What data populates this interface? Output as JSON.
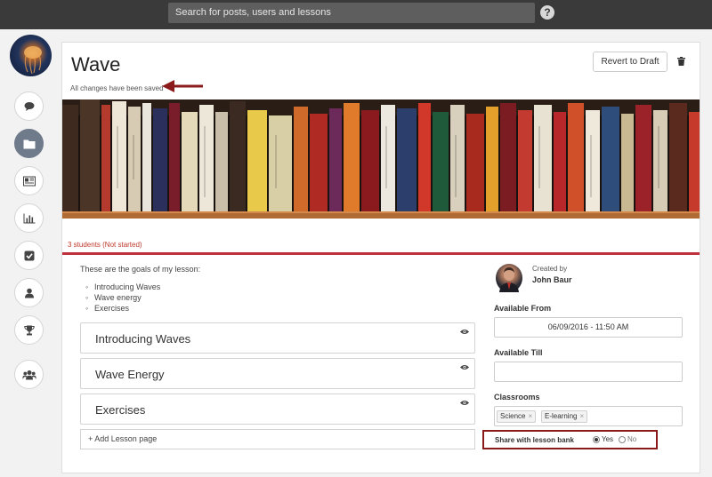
{
  "topbar": {
    "search_placeholder": "Search for posts, users and lessons",
    "help_label": "?"
  },
  "sidebar": {
    "items": [
      {
        "name": "comment-icon",
        "active": false
      },
      {
        "name": "folder-icon",
        "active": true
      },
      {
        "name": "newspaper-icon",
        "active": false
      },
      {
        "name": "bar-chart-icon",
        "active": false
      },
      {
        "name": "checkbox-icon",
        "active": false
      },
      {
        "name": "user-icon",
        "active": false
      },
      {
        "name": "trophy-icon",
        "active": false
      },
      {
        "name": "users-icon",
        "active": false
      }
    ]
  },
  "lesson": {
    "title": "Wave",
    "save_status": "All changes have been saved",
    "revert_label": "Revert to Draft",
    "students_status": "3 students (Not started)",
    "goals_intro": "These are the goals of my lesson:",
    "goals": [
      "Introducing Waves",
      "Wave energy",
      "Exercises"
    ],
    "sections": [
      "Introducing Waves",
      "Wave Energy",
      "Exercises"
    ],
    "add_page_label": "+ Add Lesson page"
  },
  "details": {
    "created_by_label": "Created by",
    "creator_name": "John Baur",
    "available_from_label": "Available From",
    "available_from_value": "06/09/2016 - 11:50 AM",
    "available_till_label": "Available Till",
    "available_till_value": "",
    "classrooms_label": "Classrooms",
    "classrooms": [
      "Science",
      "E-learning"
    ],
    "tag_remove": "×",
    "share_label": "Share with lesson bank",
    "share_yes": "Yes",
    "share_no": "No",
    "share_selected": "Yes"
  },
  "colors": {
    "topbar": "#3a3a3a",
    "accent_red": "#c0313f",
    "annotation_red": "#8b1a1a",
    "active_sidebar": "#6f7a8b"
  }
}
